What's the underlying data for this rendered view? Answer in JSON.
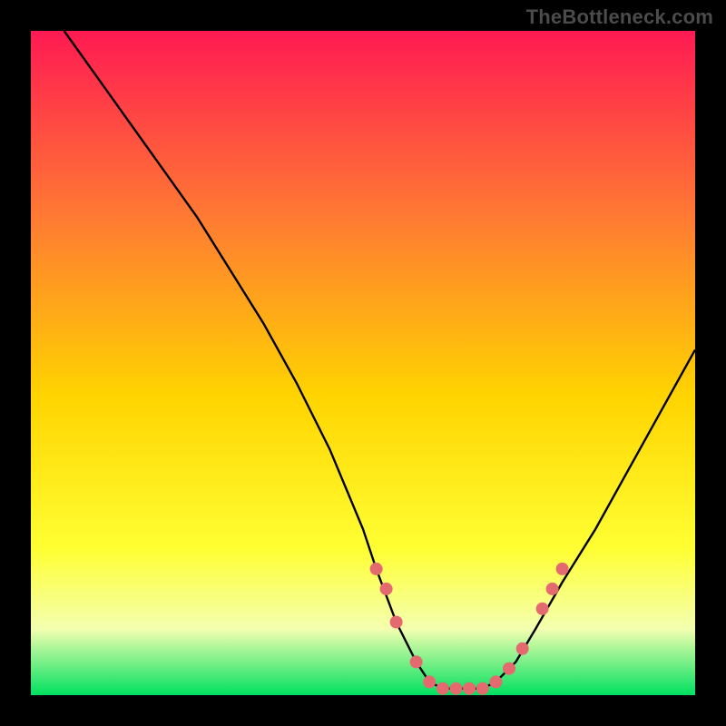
{
  "watermark": "TheBottleneck.com",
  "colors": {
    "frame": "#000000",
    "gradient_top": "#ff1a52",
    "gradient_mid1": "#ff7a33",
    "gradient_mid2": "#ffd400",
    "gradient_low": "#ffff33",
    "gradient_pale": "#f4ffb0",
    "gradient_green": "#00e060",
    "curve": "#000000",
    "marker": "#e46a6f"
  },
  "chart_data": {
    "type": "line",
    "title": "",
    "xlabel": "",
    "ylabel": "",
    "xlim": [
      0,
      100
    ],
    "ylim": [
      0,
      100
    ],
    "series": [
      {
        "name": "bottleneck-curve",
        "x": [
          5,
          10,
          15,
          20,
          25,
          30,
          35,
          40,
          45,
          50,
          52,
          55,
          58,
          60,
          62,
          65,
          68,
          70,
          73,
          76,
          80,
          85,
          90,
          95,
          100
        ],
        "y": [
          100,
          93,
          86,
          79,
          72,
          64,
          56,
          47,
          37,
          25,
          19,
          11,
          5,
          2,
          1,
          1,
          1,
          2,
          5,
          10,
          17,
          25,
          34,
          43,
          52
        ]
      }
    ],
    "markers": {
      "name": "highlighted-points",
      "x": [
        52,
        53.5,
        55,
        58,
        60,
        62,
        64,
        66,
        68,
        70,
        72,
        74,
        77,
        78.5,
        80
      ],
      "y": [
        19,
        16,
        11,
        5,
        2,
        1,
        1,
        1,
        1,
        2,
        4,
        7,
        13,
        16,
        19
      ]
    }
  }
}
